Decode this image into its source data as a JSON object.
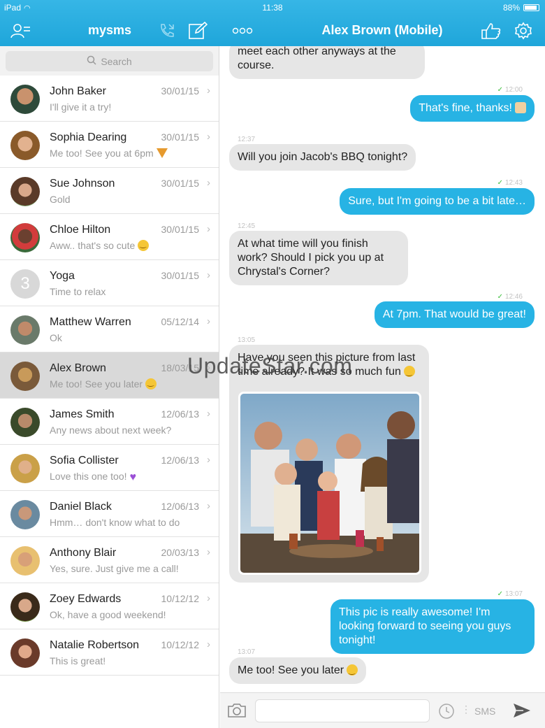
{
  "status_bar": {
    "device": "iPad",
    "time": "11:38",
    "battery": "88%"
  },
  "left_header": {
    "title": "mysms"
  },
  "chat_header": {
    "title": "Alex Brown (Mobile)"
  },
  "search": {
    "placeholder": "Search"
  },
  "conversations": [
    {
      "name": "John Baker",
      "date": "30/01/15",
      "preview": "I'll give it a try!",
      "emoji": ""
    },
    {
      "name": "Sophia Dearing",
      "date": "30/01/15",
      "preview": "Me too! See you at 6pm",
      "emoji": "pizza"
    },
    {
      "name": "Sue Johnson",
      "date": "30/01/15",
      "preview": "Gold",
      "emoji": ""
    },
    {
      "name": "Chloe Hilton",
      "date": "30/01/15",
      "preview": "Aww.. that's so cute",
      "emoji": "smile"
    },
    {
      "name": "Yoga",
      "date": "30/01/15",
      "preview": "Time to relax",
      "emoji": "",
      "avatar_letter": "3"
    },
    {
      "name": "Matthew Warren",
      "date": "05/12/14",
      "preview": "Ok",
      "emoji": ""
    },
    {
      "name": "Alex Brown",
      "date": "18/03/15",
      "preview": "Me too! See you later",
      "emoji": "smile",
      "selected": true
    },
    {
      "name": "James Smith",
      "date": "12/06/13",
      "preview": "Any news about next week?",
      "emoji": ""
    },
    {
      "name": "Sofia Collister",
      "date": "12/06/13",
      "preview": "Love this one too!",
      "emoji": "heart"
    },
    {
      "name": "Daniel Black",
      "date": "12/06/13",
      "preview": "Hmm… don't know what to do",
      "emoji": ""
    },
    {
      "name": "Anthony Blair",
      "date": "20/03/13",
      "preview": "Yes, sure. Just give me a call!",
      "emoji": ""
    },
    {
      "name": "Zoey Edwards",
      "date": "10/12/12",
      "preview": "Ok, have a good weekend!",
      "emoji": ""
    },
    {
      "name": "Natalie Robertson",
      "date": "10/12/12",
      "preview": "This is great!",
      "emoji": ""
    }
  ],
  "messages": {
    "m1_text": "meet each other anyways at the course.",
    "m2_time": "12:00",
    "m2_text": "That's fine, thanks!",
    "m3_time": "12:37",
    "m3_text": "Will you join Jacob's BBQ tonight?",
    "m4_time": "12:43",
    "m4_text": "Sure, but I'm going to be a bit late…",
    "m5_time": "12:45",
    "m5_text": "At what time will you finish work? Should I pick you up at Chrystal's Corner?",
    "m6_time": "12:46",
    "m6_text": "At 7pm. That would be great!",
    "m7_time": "13:05",
    "m7_text": "Have you seen this picture from last time already? It was so much fun",
    "m8_time": "13:07",
    "m8_text": "This pic is really awesome! I'm looking forward to seeing you guys tonight!",
    "m9_time": "13:07",
    "m9_text": "Me too! See you later"
  },
  "composer": {
    "sms_label": "SMS"
  },
  "watermark": "UpdateStar.com",
  "colors": {
    "accent": "#27b3e4",
    "header": "#23a9dc",
    "incoming": "#e6e6e6"
  }
}
